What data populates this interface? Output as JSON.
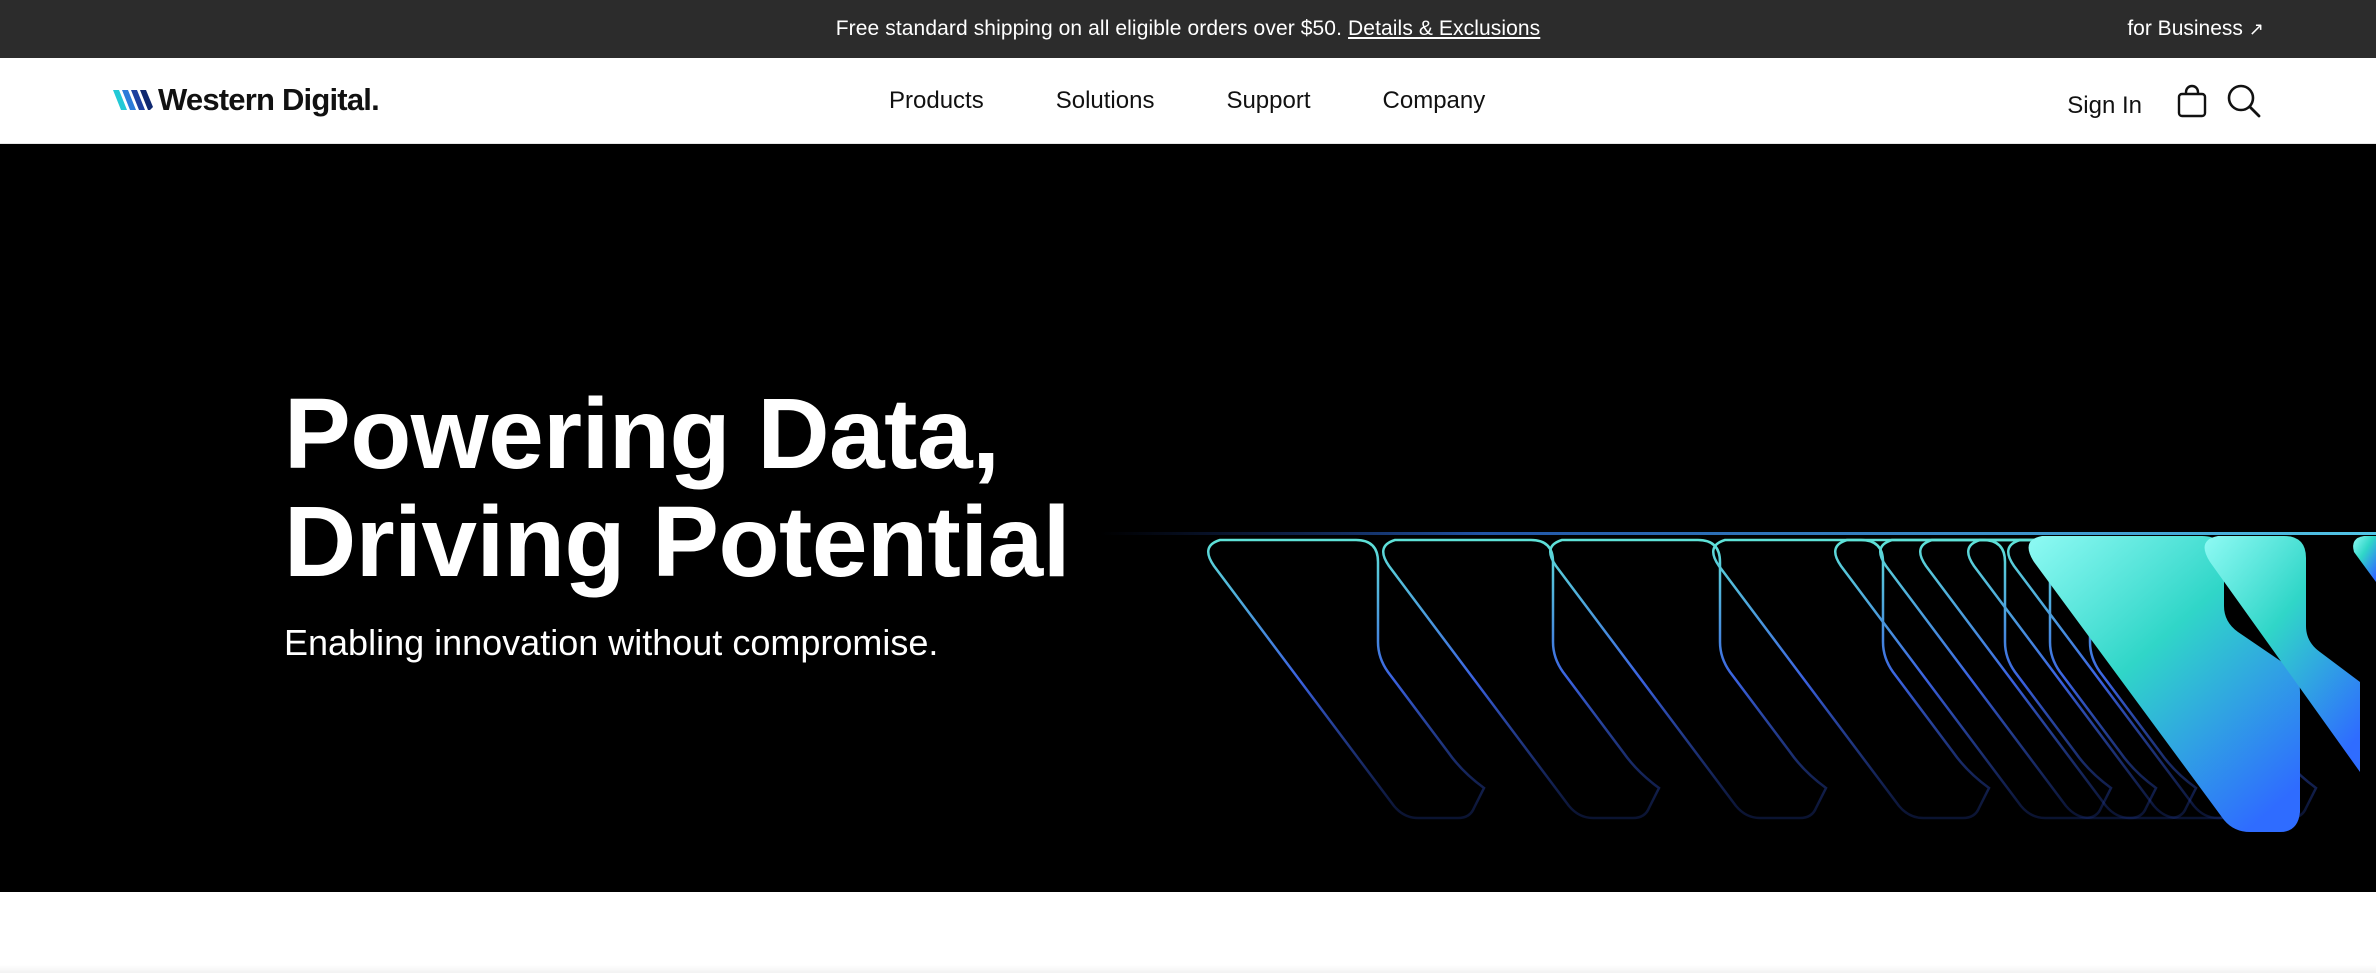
{
  "promo": {
    "text": "Free standard shipping on all eligible orders over $50.",
    "link_label": "Details & Exclusions",
    "business_label": "for Business",
    "business_arrow": "↗"
  },
  "header": {
    "logo_text": "Western Digital.",
    "nav": [
      {
        "label": "Products"
      },
      {
        "label": "Solutions"
      },
      {
        "label": "Support"
      },
      {
        "label": "Company"
      }
    ],
    "sign_in_label": "Sign In",
    "cart_icon": "shopping-bag-icon",
    "search_icon": "search-icon"
  },
  "hero": {
    "title": "Powering Data,\nDriving Potential",
    "subtitle": "Enabling innovation without compromise."
  },
  "colors": {
    "promo_bg": "#2c2c2c",
    "hero_bg": "#000000",
    "accent_cyan": "#7ef3f0",
    "accent_blue": "#2f6cff"
  }
}
